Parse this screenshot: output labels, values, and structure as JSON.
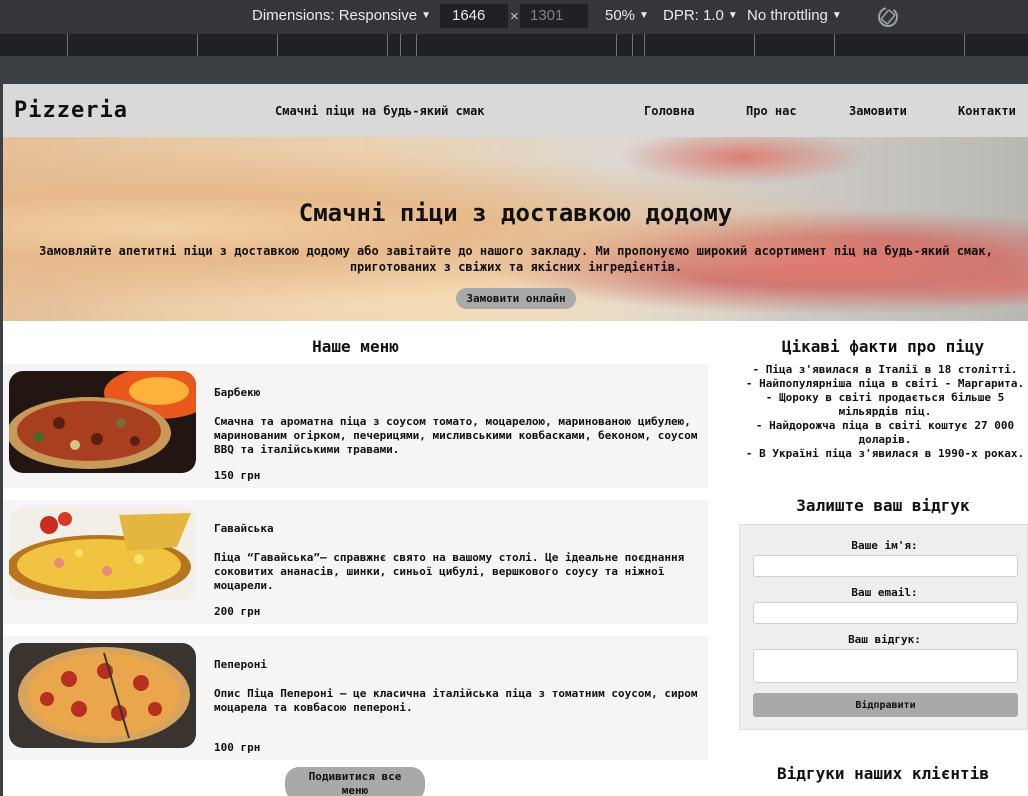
{
  "devtools": {
    "dimensions_label": "Dimensions: Responsive",
    "width_value": "1646",
    "times": "×",
    "height_placeholder": "1301",
    "zoom": "50%",
    "dpr": "DPR: 1.0",
    "throttling": "No throttling",
    "rotate_icon": "rotate-icon"
  },
  "header": {
    "logo": "Pizzeria",
    "tagline": "Смачні піци на будь-який смак",
    "nav": [
      "Головна",
      "Про нас",
      "Замовити",
      "Контакти"
    ]
  },
  "hero": {
    "title": "Смачні піци з доставкою додому",
    "text": "Замовляйте апетитні піци з доставкою додому або завітайте до нашого закладу. Ми пропонуємо широкий асортимент піц на будь-який смак, приготованих з свіжих та якісних інгредієнтів.",
    "button": "Замовити онлайн"
  },
  "menu": {
    "title": "Наше меню",
    "items": [
      {
        "name": "Барбекю",
        "description": "Смачна та ароматна піца з соусом томато, моцарелою, маринованою цибулею, маринованим огірком, печерицями, мисливськими ковбасками, беконом, соусом BBQ та італійськими травами.",
        "price": "150 грн"
      },
      {
        "name": "Гавайська",
        "description": "Піца “Гавайська”— справжнє свято на вашому столі. Це ідеальне поєднання соковитих ананасів, шинки, синьої цибулі, вершкового соусу та ніжної моцарели.",
        "price": "200 грн"
      },
      {
        "name": "Пепероні",
        "description": "Опис Піца Пепероні – це класична італійська піца з томатним соусом, сиром моцарела та ковбасою пепероні.",
        "price": "100 грн"
      }
    ],
    "more_button": "Подивитися все меню"
  },
  "facts": {
    "title": "Цікаві факти про піцу",
    "items": [
      "- Піца з'явилася в Італії в 18 столітті.",
      "- Найпопулярніша піца в світі - Маргарита.",
      "- Щороку в світі продається більше 5 мільярдів піц.",
      "- Найдорожча піца в світі коштує 27 000 доларів.",
      "- В Україні піца з'явилася в 1990-х роках."
    ]
  },
  "review_form": {
    "title": "Залиште ваш відгук",
    "name_label": "Ваше ім'я:",
    "email_label": "Ваш email:",
    "review_label": "Ваш відгук:",
    "submit": "Відправити"
  },
  "clients": {
    "title": "Відгуки наших клієнтів"
  }
}
